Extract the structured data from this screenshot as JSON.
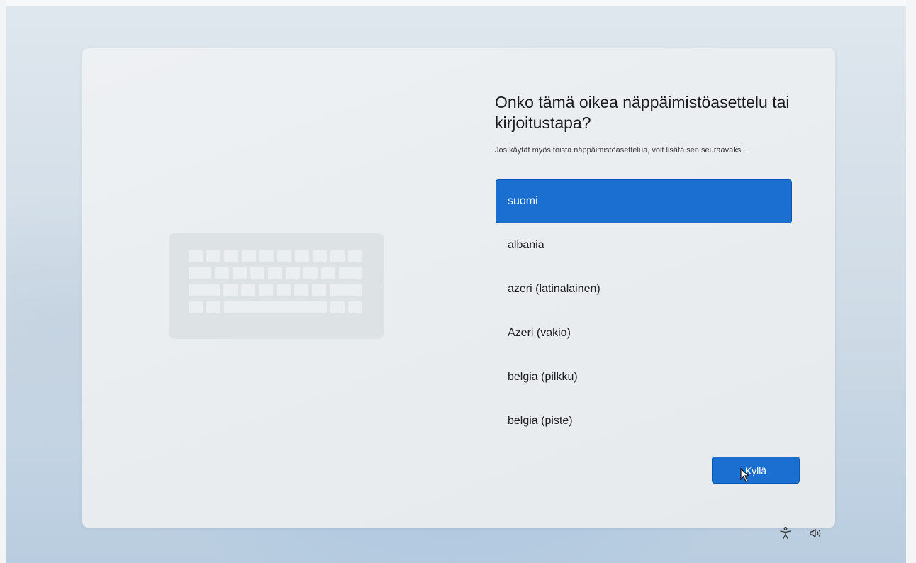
{
  "setup": {
    "title": "Onko tämä oikea näppäimistöasettelu tai kirjoitustapa?",
    "subtitle": "Jos käytät myös toista näppäimistöasettelua, voit lisätä sen seuraavaksi.",
    "layouts": [
      {
        "label": "suomi",
        "selected": true
      },
      {
        "label": "albania",
        "selected": false
      },
      {
        "label": "azeri (latinalainen)",
        "selected": false
      },
      {
        "label": "Azeri (vakio)",
        "selected": false
      },
      {
        "label": "belgia (pilkku)",
        "selected": false
      },
      {
        "label": "belgia (piste)",
        "selected": false
      }
    ],
    "confirm_label": "Kyllä"
  },
  "tray": {
    "icons": [
      "accessibility-icon",
      "volume-icon"
    ]
  },
  "colors": {
    "accent": "#1a6fd1",
    "card": "#eceff1"
  }
}
